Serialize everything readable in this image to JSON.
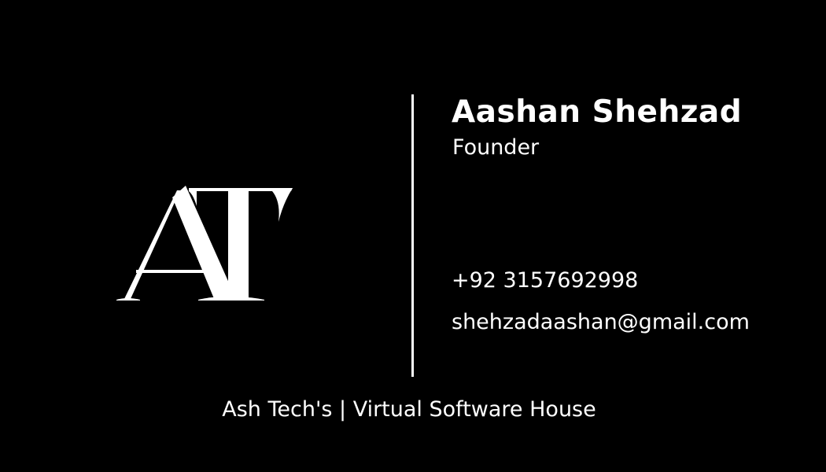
{
  "card": {
    "logo_text": "AT",
    "name": "Aashan Shehzad",
    "role": "Founder",
    "phone": "+92 3157692998",
    "email": "shehzadaashan@gmail.com",
    "footer": "Ash Tech's | Virtual Software House"
  },
  "colors": {
    "background": "#000000",
    "foreground": "#ffffff"
  }
}
